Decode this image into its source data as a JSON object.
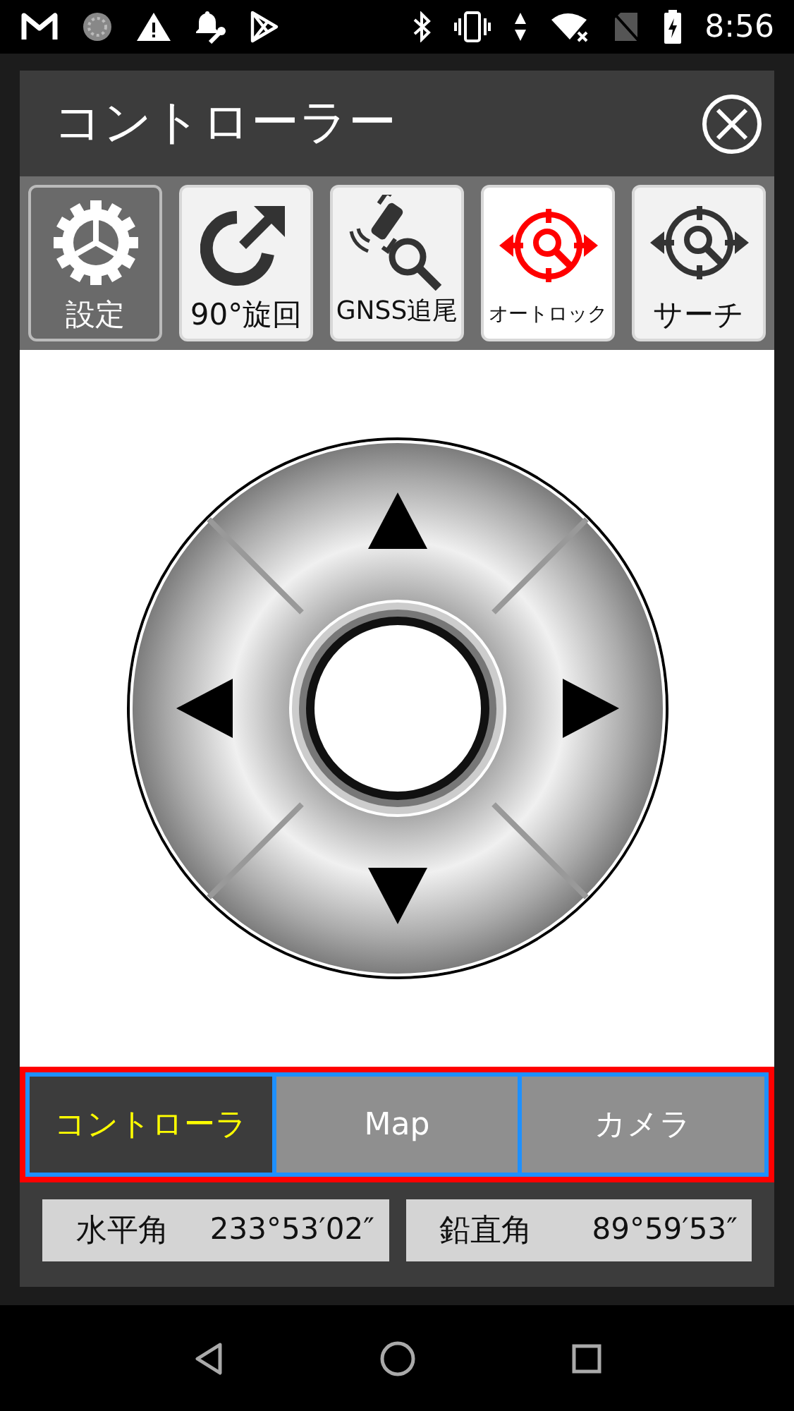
{
  "status_bar": {
    "time": "8:56"
  },
  "dialog": {
    "title": "コントローラー"
  },
  "toolbar": [
    {
      "label": "設定",
      "kind": "menu",
      "on": false
    },
    {
      "label": "90°旋回",
      "kind": "toggle",
      "on": false
    },
    {
      "label": "GNSS追尾",
      "kind": "toggle",
      "on": false
    },
    {
      "label": "オートロック",
      "kind": "toggle",
      "on": true
    },
    {
      "label": "サーチ",
      "kind": "toggle",
      "on": false
    }
  ],
  "tabs": [
    {
      "label": "コントローラ",
      "selected": true
    },
    {
      "label": "Map",
      "selected": false
    },
    {
      "label": "カメラ",
      "selected": false
    }
  ],
  "readings": [
    {
      "label": "水平角",
      "value": "233°53′02″"
    },
    {
      "label": "鉛直角",
      "value": "89°59′53″"
    }
  ]
}
